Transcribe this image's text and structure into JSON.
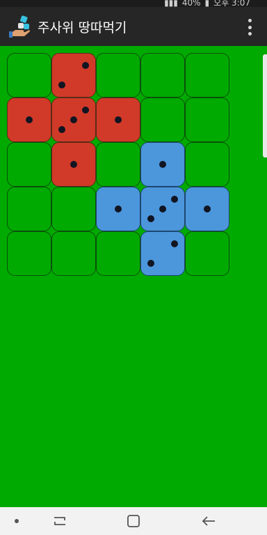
{
  "status_bar": {
    "battery": "40%",
    "time": "오후 3:07"
  },
  "app_bar": {
    "title": "주사위 땅따먹기",
    "icon": "dice-hand-icon",
    "menu_icon": "overflow-menu-icon"
  },
  "board": {
    "rows": 5,
    "cols": 5,
    "colors": {
      "empty": "#00aa00",
      "red": "#d13a28",
      "blue": "#4c96dc",
      "pip": "#111522"
    },
    "cells": [
      [
        {
          "owner": "empty",
          "value": 0
        },
        {
          "owner": "red",
          "value": 2
        },
        {
          "owner": "empty",
          "value": 0
        },
        {
          "owner": "empty",
          "value": 0
        },
        {
          "owner": "empty",
          "value": 0
        }
      ],
      [
        {
          "owner": "red",
          "value": 1
        },
        {
          "owner": "red",
          "value": 3
        },
        {
          "owner": "red",
          "value": 1
        },
        {
          "owner": "empty",
          "value": 0
        },
        {
          "owner": "empty",
          "value": 0
        }
      ],
      [
        {
          "owner": "empty",
          "value": 0
        },
        {
          "owner": "red",
          "value": 1
        },
        {
          "owner": "empty",
          "value": 0
        },
        {
          "owner": "blue",
          "value": 1
        },
        {
          "owner": "empty",
          "value": 0
        }
      ],
      [
        {
          "owner": "empty",
          "value": 0
        },
        {
          "owner": "empty",
          "value": 0
        },
        {
          "owner": "blue",
          "value": 1
        },
        {
          "owner": "blue",
          "value": 3
        },
        {
          "owner": "blue",
          "value": 1
        }
      ],
      [
        {
          "owner": "empty",
          "value": 0
        },
        {
          "owner": "empty",
          "value": 0
        },
        {
          "owner": "empty",
          "value": 0
        },
        {
          "owner": "blue",
          "value": 2
        },
        {
          "owner": "empty",
          "value": 0
        }
      ]
    ]
  },
  "nav_bar": {
    "items": [
      "dot-icon",
      "recent-apps-icon",
      "home-icon",
      "back-icon"
    ]
  }
}
